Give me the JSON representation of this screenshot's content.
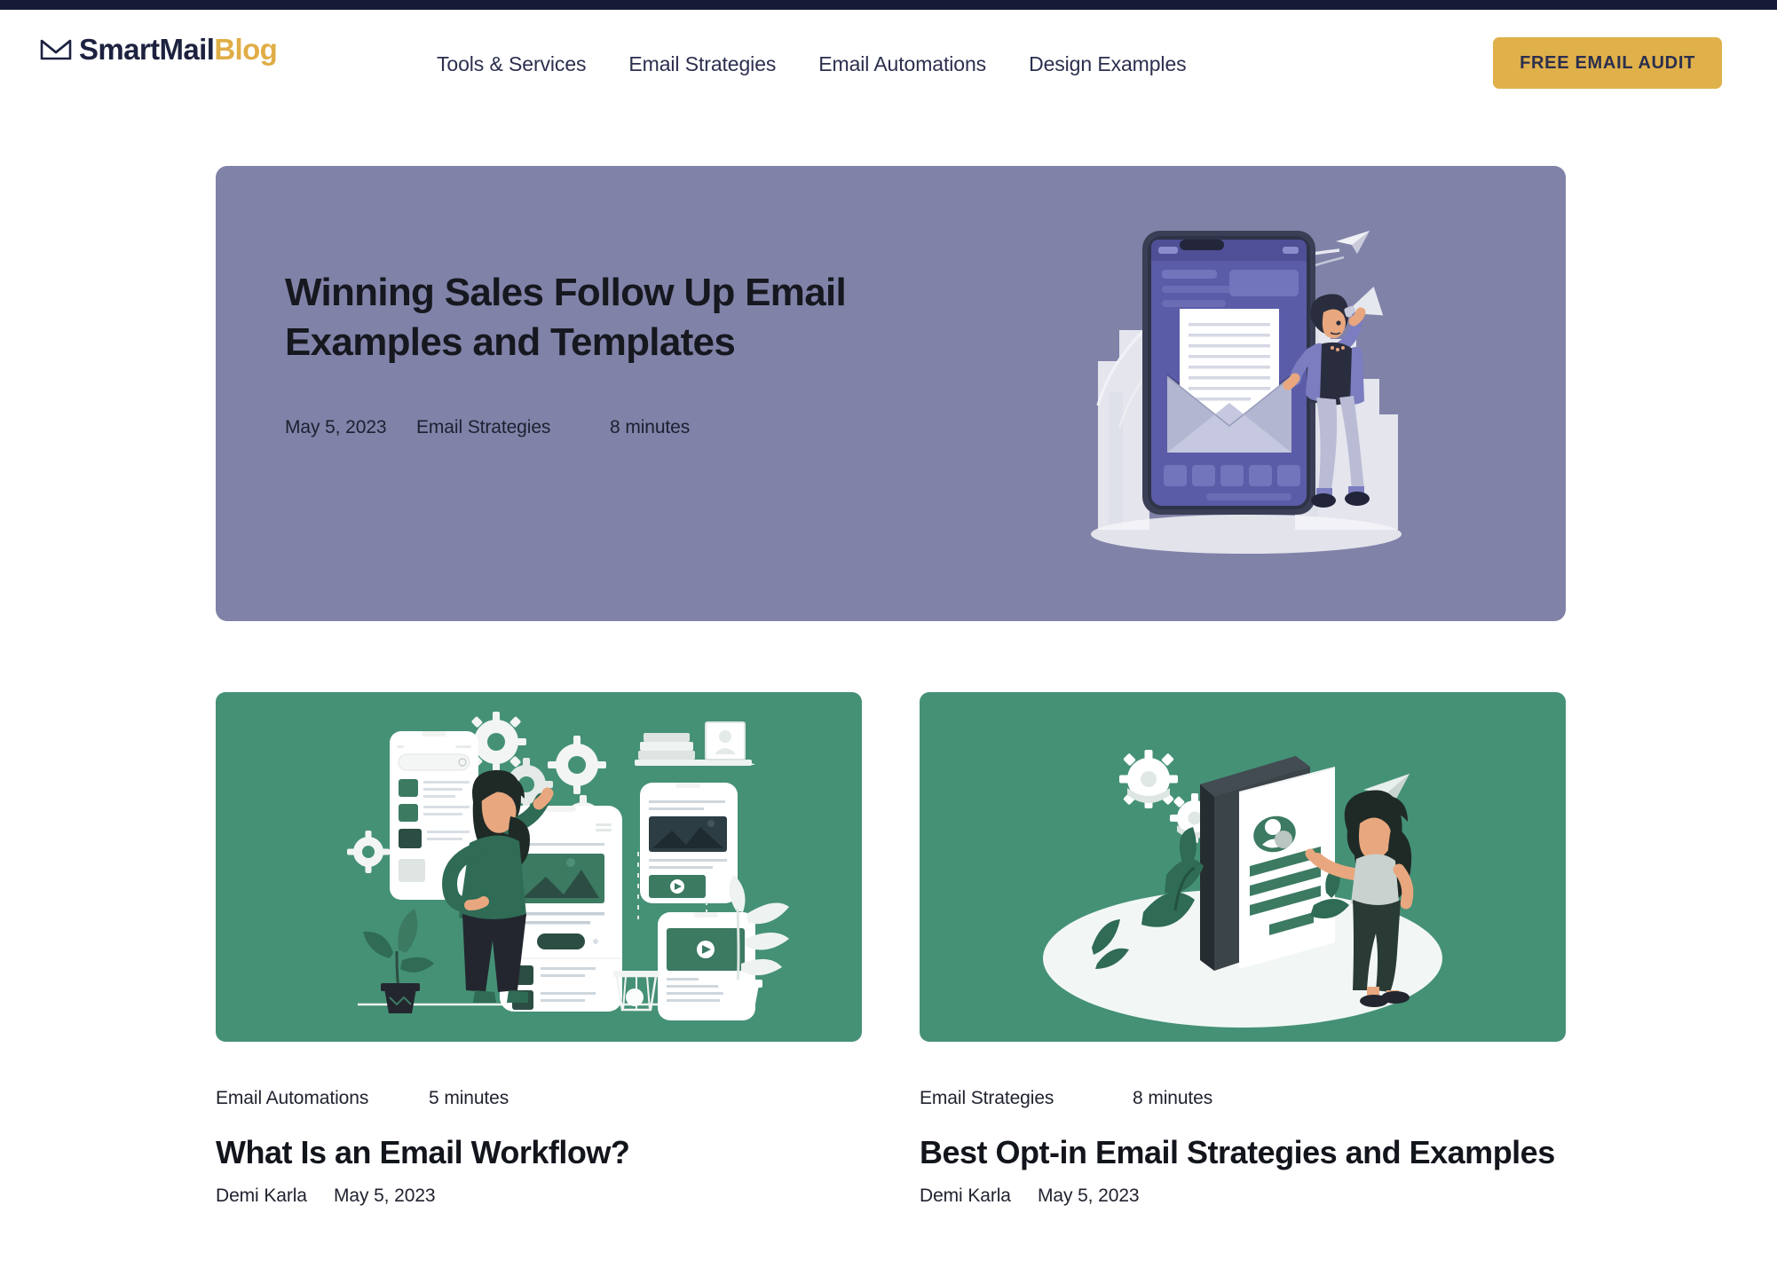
{
  "theme": {
    "top_strip_color": "#161A36",
    "accent_gold": "#E0B04A",
    "hero_card_color": "#8182A8",
    "post_card_color": "#459176",
    "text_dark": "#2B2F4E"
  },
  "header": {
    "logo": {
      "icon": "envelope-icon",
      "text_primary": "SmartMail",
      "text_accent": "Blog"
    },
    "nav": [
      {
        "label": "Tools & Services"
      },
      {
        "label": "Email Strategies"
      },
      {
        "label": "Email Automations"
      },
      {
        "label": "Design Examples"
      }
    ],
    "cta": {
      "label": "FREE EMAIL AUDIT"
    }
  },
  "hero": {
    "title": "Winning Sales Follow Up Email Examples and Templates",
    "date": "May 5, 2023",
    "category": "Email Strategies",
    "read_time": "8 minutes",
    "illustration": "phone-envelope-megaphone-illustration"
  },
  "posts": [
    {
      "category": "Email Automations",
      "read_time": "5 minutes",
      "title": "What Is an Email Workflow?",
      "author": "Demi Karla",
      "date": "May 5, 2023",
      "illustration": "woman-phone-mockups-gears-illustration"
    },
    {
      "category": "Email Strategies",
      "read_time": "8 minutes",
      "title": "Best Opt-in Email Strategies and Examples",
      "author": "Demi Karla",
      "date": "May 5, 2023",
      "illustration": "isometric-phone-signup-form-illustration"
    }
  ]
}
